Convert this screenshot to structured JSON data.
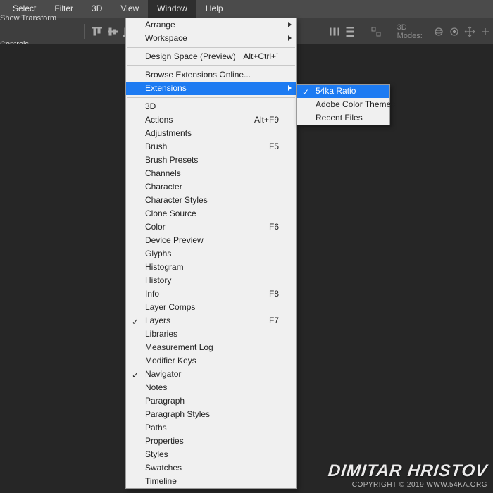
{
  "menubar": {
    "items": [
      {
        "label": "Select"
      },
      {
        "label": "Filter"
      },
      {
        "label": "3D"
      },
      {
        "label": "View"
      },
      {
        "label": "Window",
        "active": true
      },
      {
        "label": "Help"
      }
    ]
  },
  "optionsbar": {
    "show_transform_label": "Show Transform Controls",
    "modes_label": "3D Modes:"
  },
  "window_menu": {
    "arrange": "Arrange",
    "workspace": "Workspace",
    "design_space": {
      "label": "Design Space (Preview)",
      "shortcut": "Alt+Ctrl+`"
    },
    "browse_ext": "Browse Extensions Online...",
    "extensions": "Extensions",
    "items": [
      {
        "label": "3D"
      },
      {
        "label": "Actions",
        "shortcut": "Alt+F9"
      },
      {
        "label": "Adjustments"
      },
      {
        "label": "Brush",
        "shortcut": "F5"
      },
      {
        "label": "Brush Presets"
      },
      {
        "label": "Channels"
      },
      {
        "label": "Character"
      },
      {
        "label": "Character Styles"
      },
      {
        "label": "Clone Source"
      },
      {
        "label": "Color",
        "shortcut": "F6"
      },
      {
        "label": "Device Preview"
      },
      {
        "label": "Glyphs"
      },
      {
        "label": "Histogram"
      },
      {
        "label": "History"
      },
      {
        "label": "Info",
        "shortcut": "F8"
      },
      {
        "label": "Layer Comps"
      },
      {
        "label": "Layers",
        "shortcut": "F7",
        "checked": true
      },
      {
        "label": "Libraries"
      },
      {
        "label": "Measurement Log"
      },
      {
        "label": "Modifier Keys"
      },
      {
        "label": "Navigator",
        "checked": true
      },
      {
        "label": "Notes"
      },
      {
        "label": "Paragraph"
      },
      {
        "label": "Paragraph Styles"
      },
      {
        "label": "Paths"
      },
      {
        "label": "Properties"
      },
      {
        "label": "Styles"
      },
      {
        "label": "Swatches"
      },
      {
        "label": "Timeline"
      }
    ]
  },
  "extensions_submenu": [
    {
      "label": "54ka Ratio",
      "checked": true,
      "highlight": true
    },
    {
      "label": "Adobe Color Themes"
    },
    {
      "label": "Recent Files"
    }
  ],
  "watermark": {
    "top": "DIMITAR HRISTOV",
    "bottom": "COPYRIGHT © 2019 WWW.54KA.ORG"
  }
}
